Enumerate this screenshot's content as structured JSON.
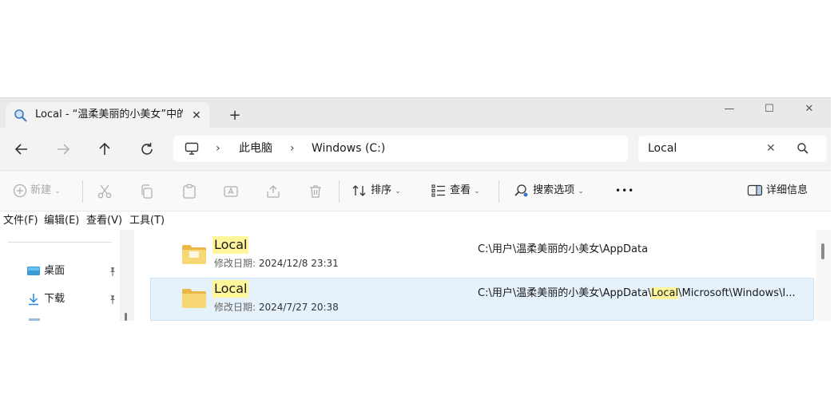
{
  "tab": {
    "title": "Local - “温柔美丽的小美女”中的"
  },
  "breadcrumb": {
    "items": [
      "此电脑",
      "Windows (C:)"
    ]
  },
  "search": {
    "value": "Local"
  },
  "toolbar": {
    "new_label": "新建",
    "sort_label": "排序",
    "view_label": "查看",
    "search_options_label": "搜索选项",
    "more_label": "•••",
    "details_label": "详细信息"
  },
  "menu": [
    "文件(F)",
    "编辑(E)",
    "查看(V)",
    "工具(T)"
  ],
  "sidebar": {
    "items": [
      {
        "label": "桌面",
        "icon": "desktop-icon"
      },
      {
        "label": "下载",
        "icon": "download-icon"
      }
    ]
  },
  "results": [
    {
      "name": "Local",
      "date_label": "修改日期:",
      "date": "2024/12/8 23:31",
      "path": "C:\\用户\\温柔美丽的小美女\\AppData",
      "selected": false
    },
    {
      "name": "Local",
      "date_label": "修改日期:",
      "date": "2024/7/27 20:38",
      "path_before": "C:\\用户\\温柔美丽的小美女\\AppData\\",
      "path_hl": "Local",
      "path_after": "\\Microsoft\\Windows\\I...",
      "selected": true
    }
  ],
  "colors": {
    "accent": "#0067c0",
    "highlight": "#fff59a",
    "selection": "#e5f1fb",
    "folder": "#f8d775"
  }
}
